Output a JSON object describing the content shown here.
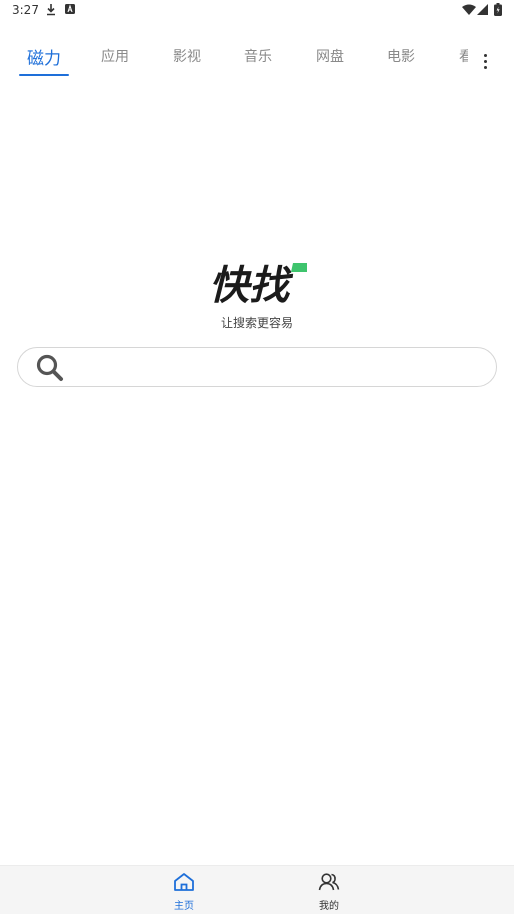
{
  "status": {
    "time": "3:27"
  },
  "tabs": [
    {
      "label": "磁力",
      "active": true
    },
    {
      "label": "应用"
    },
    {
      "label": "影视"
    },
    {
      "label": "音乐"
    },
    {
      "label": "网盘"
    },
    {
      "label": "电影"
    },
    {
      "label": "看"
    }
  ],
  "logo": {
    "text": "快找",
    "accent": "#3ec46d"
  },
  "slogan": "让搜索更容易",
  "search": {
    "placeholder": "",
    "value": ""
  },
  "bottom_nav": [
    {
      "label": "主页",
      "active": true
    },
    {
      "label": "我的"
    }
  ],
  "colors": {
    "accent": "#1e6fd9",
    "tab_inactive": "#8a8a8a"
  }
}
